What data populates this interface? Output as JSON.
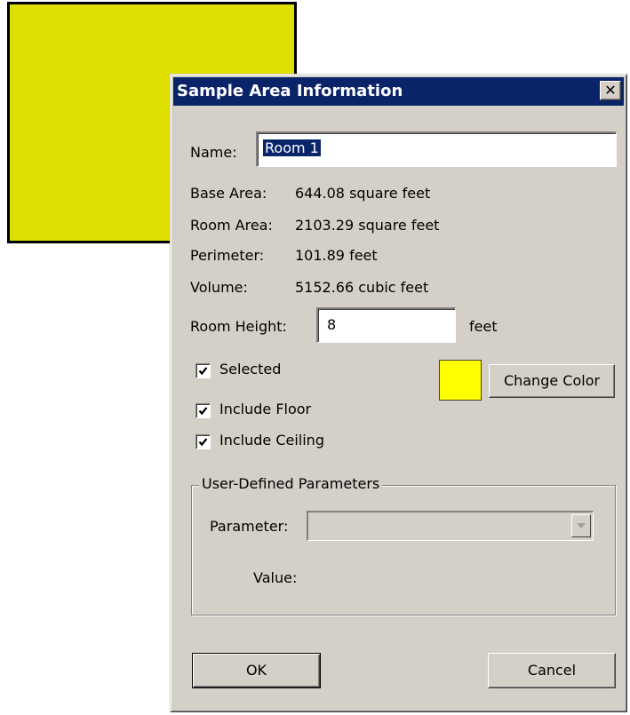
{
  "colors": {
    "room_fill": "#dede00",
    "swatch_color": "#ffff00",
    "titlebar": "#0a246a",
    "dialog_bg": "#d4d0c8"
  },
  "dialog": {
    "title": "Sample Area Information",
    "close_glyph": "✕"
  },
  "name": {
    "label": "Name:",
    "value": "Room 1"
  },
  "info": {
    "base_area_label": "Base Area:",
    "base_area_value": "644.08 square feet",
    "room_area_label": "Room Area:",
    "room_area_value": "2103.29 square feet",
    "perimeter_label": "Perimeter:",
    "perimeter_value": "101.89 feet",
    "volume_label": "Volume:",
    "volume_value": "5152.66 cubic feet"
  },
  "room_height": {
    "label": "Room Height:",
    "value": "8",
    "unit": "feet"
  },
  "checkboxes": {
    "selected": {
      "label": "Selected",
      "checked": true
    },
    "include_floor": {
      "label": "Include Floor",
      "checked": true
    },
    "include_ceiling": {
      "label": "Include Ceiling",
      "checked": true
    }
  },
  "color": {
    "change_color_label": "Change Color"
  },
  "parameters": {
    "group_label": "User-Defined Parameters",
    "parameter_label": "Parameter:",
    "parameter_value": "",
    "value_label": "Value:"
  },
  "buttons": {
    "ok": "OK",
    "cancel": "Cancel"
  }
}
